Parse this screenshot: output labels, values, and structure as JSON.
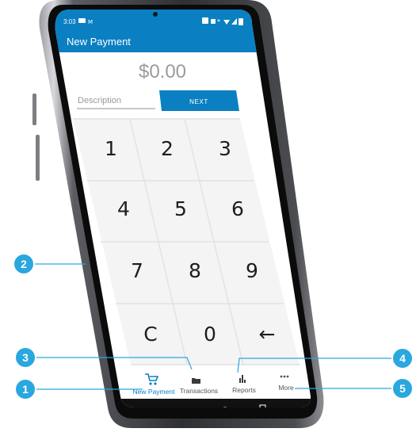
{
  "status_bar": {
    "time": "3:03"
  },
  "app_bar": {
    "title": "New Payment"
  },
  "amount": {
    "value": "$0.00"
  },
  "description": {
    "placeholder": "Description"
  },
  "next_button": {
    "label": "NEXT"
  },
  "keypad": {
    "keys": [
      "1",
      "2",
      "3",
      "4",
      "5",
      "6",
      "7",
      "8",
      "9",
      "C",
      "0",
      "←"
    ]
  },
  "bottom_nav": {
    "items": [
      {
        "label": "New Payment",
        "icon": "cart-icon",
        "active": true
      },
      {
        "label": "Transactions",
        "icon": "folder-icon",
        "active": false
      },
      {
        "label": "Reports",
        "icon": "bar-chart-icon",
        "active": false
      },
      {
        "label": "More",
        "icon": "more-dots-icon",
        "active": false
      }
    ]
  },
  "callouts": [
    "1",
    "2",
    "3",
    "4",
    "5"
  ],
  "colors": {
    "primary": "#0a7fc2",
    "callout": "#2aa7de",
    "frame": "#3a3c40"
  }
}
